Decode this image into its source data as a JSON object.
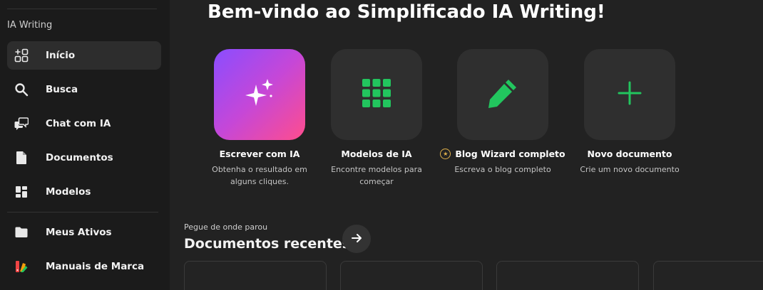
{
  "sidebar": {
    "section_label": "IA Writing",
    "items": [
      {
        "label": "Início",
        "icon": "dashboard-plus-icon",
        "active": true
      },
      {
        "label": "Busca",
        "icon": "search-icon"
      },
      {
        "label": "Chat com IA",
        "icon": "chat-icon"
      },
      {
        "label": "Documentos",
        "icon": "document-icon"
      },
      {
        "label": "Modelos",
        "icon": "templates-icon"
      },
      {
        "label": "Meus Ativos",
        "icon": "folder-icon"
      },
      {
        "label": "Manuais de Marca",
        "icon": "brand-palette-icon"
      }
    ]
  },
  "main": {
    "welcome": "Bem-vindo ao Simplificado IA Writing!",
    "cards": [
      {
        "title": "Escrever com IA",
        "desc": "Obtenha o resultado em alguns cliques.",
        "icon": "sparkles-icon"
      },
      {
        "title": "Modelos de IA",
        "desc": "Encontre modelos para começar",
        "icon": "grid-icon"
      },
      {
        "title": "Blog Wizard completo",
        "desc": "Escreva o blog completo",
        "icon": "pencil-icon",
        "premium": true
      },
      {
        "title": "Novo documento",
        "desc": "Crie um novo documento",
        "icon": "plus-icon"
      }
    ],
    "recent": {
      "subtitle": "Pegue de onde parou",
      "title": "Documentos recentes"
    }
  },
  "colors": {
    "background": "#222222",
    "sidebar": "#1b1b1b",
    "accent_green": "#22c55e",
    "gradient_start": "#8a4dff",
    "gradient_end": "#ff4d8d",
    "premium_gold": "#e0b04a"
  }
}
